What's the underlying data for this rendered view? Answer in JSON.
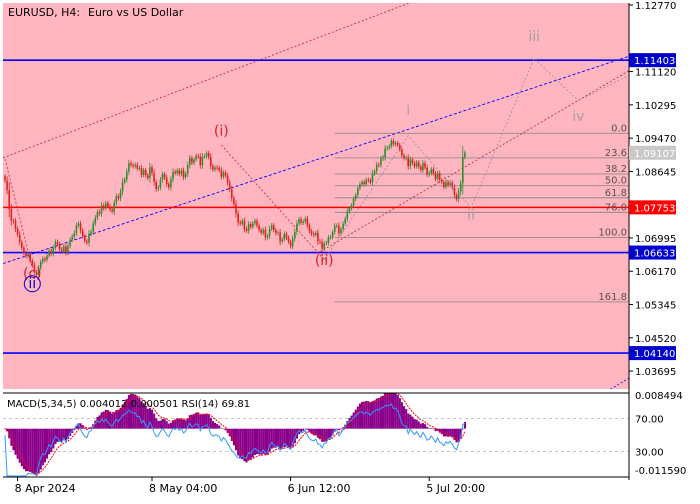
{
  "header": {
    "symbol": "EURUSD, H4:",
    "description": "Euro vs US Dollar"
  },
  "colors": {
    "background": "#ffffff",
    "main_panel_bg": "#ffb6c1",
    "axis_text": "#000000",
    "candle_up": "#2e8b2e",
    "candle_down": "#e0201b",
    "level_blue": "#0000ff",
    "level_red": "#ff0000",
    "label_blue_bg": "#0000cc",
    "label_red_bg": "#ff0000",
    "label_gray_bg": "#c8c8c8",
    "fib_line": "#808080",
    "fib_text": "#555555",
    "wave_gray": "#a0a0a0",
    "wave_red": "#d62020",
    "wave_blue": "#0000cc",
    "macd_hist": "#8b008b",
    "macd_signal": "#ff0000",
    "rsi_line": "#3399ff",
    "channel_red": "#c02020",
    "channel_blue": "#0000ff"
  },
  "chart_data": {
    "type": "candlestick",
    "price_axis": {
      "ylim": [
        1.0325,
        1.1282
      ],
      "ticks": [
        "1.12770",
        "1.11120",
        "1.10295",
        "1.09470",
        "1.08645",
        "1.07820",
        "1.06995",
        "1.06170",
        "1.05345",
        "1.04520",
        "1.03695"
      ]
    },
    "price_labels": [
      {
        "value": "1.11403",
        "kind": "blue",
        "price": 1.11403
      },
      {
        "value": "1.09107",
        "kind": "gray",
        "price": 1.09107
      },
      {
        "value": "1.07753",
        "kind": "red",
        "price": 1.07753
      },
      {
        "value": "1.06633",
        "kind": "blue",
        "price": 1.06633
      },
      {
        "value": "1.04140",
        "kind": "blue",
        "price": 1.0414
      }
    ],
    "horizontal_levels": [
      {
        "price": 1.11403,
        "color": "blue"
      },
      {
        "price": 1.07753,
        "color": "red"
      },
      {
        "price": 1.06633,
        "color": "blue"
      },
      {
        "price": 1.0414,
        "color": "blue"
      }
    ],
    "fibonacci_levels": [
      {
        "label": "0.0",
        "price": 1.0959
      },
      {
        "label": "23.6",
        "price": 1.0898
      },
      {
        "label": "38.2",
        "price": 1.0858
      },
      {
        "label": "50.0",
        "price": 1.0829
      },
      {
        "label": "61.8",
        "price": 1.0799
      },
      {
        "label": "76.0",
        "price": 1.0763
      },
      {
        "label": "100.0",
        "price": 1.0701
      },
      {
        "label": "161.8",
        "price": 1.0541
      }
    ],
    "wave_labels": [
      {
        "text": "(i)",
        "color": "red",
        "circled": false,
        "t": 103,
        "price": 1.0953
      },
      {
        "text": "(ii)",
        "color": "red",
        "circled": false,
        "t": 152,
        "price": 1.0632
      },
      {
        "text": "(c)",
        "color": "red",
        "circled": false,
        "t": 13,
        "price": 1.06
      },
      {
        "text": "ii",
        "color": "blue",
        "circled": true,
        "t": 13,
        "price": 1.0576
      },
      {
        "text": "i",
        "color": "gray",
        "circled": false,
        "t": 192,
        "price": 1.1005
      },
      {
        "text": "ii",
        "color": "gray",
        "circled": false,
        "t": 222,
        "price": 1.0745
      },
      {
        "text": "iii",
        "color": "gray",
        "circled": false,
        "t": 252,
        "price": 1.1188
      },
      {
        "text": "iv",
        "color": "gray",
        "circled": false,
        "t": 273,
        "price": 1.099
      }
    ],
    "closes": [
      1.0842,
      1.0818,
      1.0771,
      1.0742,
      1.0741,
      1.0722,
      1.0708,
      1.0689,
      1.0675,
      1.0662,
      1.0654,
      1.0658,
      1.0643,
      1.0632,
      1.0615,
      1.0608,
      1.0625,
      1.064,
      1.0648,
      1.0645,
      1.0656,
      1.0668,
      1.066,
      1.0675,
      1.069,
      1.0684,
      1.0672,
      1.0666,
      1.0679,
      1.0663,
      1.068,
      1.0695,
      1.0703,
      1.0712,
      1.073,
      1.0735,
      1.0718,
      1.0704,
      1.0692,
      1.0688,
      1.071,
      1.0715,
      1.0735,
      1.075,
      1.0764,
      1.076,
      1.078,
      1.0773,
      1.0786,
      1.0778,
      1.077,
      1.0765,
      1.0786,
      1.0803,
      1.0798,
      1.0815,
      1.0838,
      1.0845,
      1.0864,
      1.0885,
      1.088,
      1.0877,
      1.0881,
      1.0871,
      1.0873,
      1.0856,
      1.0868,
      1.0855,
      1.0848,
      1.0875,
      1.086,
      1.0838,
      1.0821,
      1.0825,
      1.0843,
      1.0858,
      1.0849,
      1.0833,
      1.0825,
      1.0845,
      1.0864,
      1.086,
      1.0867,
      1.0858,
      1.0867,
      1.085,
      1.0859,
      1.088,
      1.0898,
      1.0886,
      1.0894,
      1.0903,
      1.0901,
      1.088,
      1.0901,
      1.0902,
      1.091,
      1.09,
      1.0878,
      1.0869,
      1.0874,
      1.0873,
      1.0868,
      1.0851,
      1.0862,
      1.0854,
      1.0837,
      1.082,
      1.0798,
      1.0783,
      1.076,
      1.0738,
      1.0735,
      1.0742,
      1.0722,
      1.0717,
      1.0734,
      1.0727,
      1.0736,
      1.0742,
      1.073,
      1.0719,
      1.0712,
      1.072,
      1.0701,
      1.0704,
      1.0722,
      1.0731,
      1.0719,
      1.0711,
      1.0713,
      1.0691,
      1.0696,
      1.071,
      1.07,
      1.069,
      1.0679,
      1.0698,
      1.0715,
      1.0735,
      1.0746,
      1.0737,
      1.074,
      1.0747,
      1.073,
      1.0716,
      1.071,
      1.0707,
      1.0712,
      1.0691,
      1.069,
      1.0673,
      1.0686,
      1.0687,
      1.0701,
      1.0701,
      1.0714,
      1.073,
      1.073,
      1.0711,
      1.0721,
      1.0735,
      1.0747,
      1.0765,
      1.0773,
      1.078,
      1.0796,
      1.0806,
      1.0822,
      1.0833,
      1.0838,
      1.0833,
      1.0844,
      1.0842,
      1.0838,
      1.0859,
      1.0865,
      1.0881,
      1.088,
      1.0896,
      1.09,
      1.0921,
      1.0923,
      1.0927,
      1.094,
      1.0932,
      1.0935,
      1.093,
      1.0919,
      1.0904,
      1.0897,
      1.0898,
      1.0877,
      1.0894,
      1.0885,
      1.0877,
      1.0887,
      1.0876,
      1.0868,
      1.0885,
      1.0874,
      1.0857,
      1.086,
      1.087,
      1.086,
      1.0846,
      1.086,
      1.0843,
      1.0838,
      1.0826,
      1.0838,
      1.0831,
      1.0837,
      1.0824,
      1.0806,
      1.0796,
      1.0815,
      1.0835,
      1.09,
      1.0911
    ],
    "time_axis": {
      "labels": [
        {
          "text": "8 Apr 2024",
          "t": 6
        },
        {
          "text": "8 May 04:00",
          "t": 70
        },
        {
          "text": "6 Jun 12:00",
          "t": 136
        },
        {
          "text": "5 Jul 20:00",
          "t": 202
        }
      ]
    },
    "indicator": {
      "title": "MACD(5,34,5) 0.004012 0.000501 RSI(14) 69.81",
      "macd_axis": [
        "0.008494",
        "-0.011590"
      ],
      "macd_range": [
        -0.01159,
        0.008494
      ],
      "rsi_levels": [
        {
          "label": "70.00",
          "value": 70
        },
        {
          "label": "30.00",
          "value": 30
        }
      ]
    }
  }
}
